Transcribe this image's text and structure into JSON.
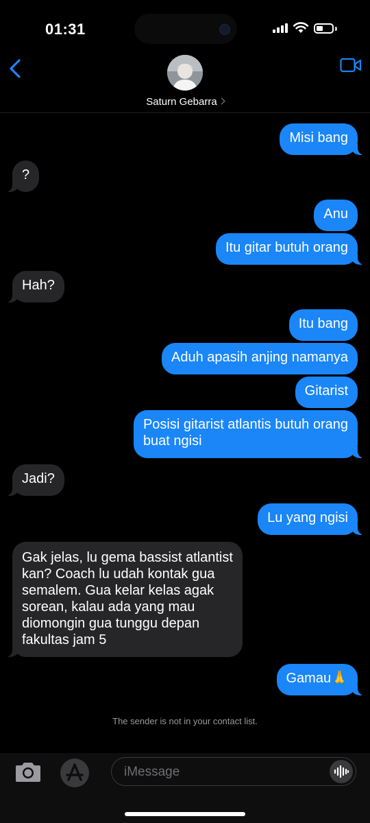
{
  "status": {
    "time": "01:31",
    "battery_level": 0.45
  },
  "header": {
    "contact_name": "Saturn Gebarra"
  },
  "messages": [
    {
      "dir": "out",
      "text": "Misi bang"
    },
    {
      "dir": "in",
      "text": "?"
    },
    {
      "dir": "out",
      "text": "Anu"
    },
    {
      "dir": "out",
      "text": "Itu gitar butuh orang"
    },
    {
      "dir": "in",
      "text": "Hah?"
    },
    {
      "dir": "out",
      "text": "Itu bang"
    },
    {
      "dir": "out",
      "text": "Aduh apasih anjing namanya"
    },
    {
      "dir": "out",
      "text": "Gitarist"
    },
    {
      "dir": "out",
      "text": "Posisi gitarist atlantis butuh orang\nbuat ngisi"
    },
    {
      "dir": "in",
      "text": "Jadi?"
    },
    {
      "dir": "out",
      "text": "Lu yang ngisi"
    },
    {
      "dir": "in",
      "text": "Gak jelas, lu gema bassist atlantist\nkan? Coach lu udah kontak gua\nsemalem. Gua kelar kelas agak\nsorean, kalau ada yang mau\ndiomongin gua tunggu depan\nfakultas jam 5"
    },
    {
      "dir": "out",
      "text": "Gamau🙏"
    }
  ],
  "notice": "The sender is not in your contact list.",
  "composer": {
    "placeholder": "iMessage"
  },
  "colors": {
    "accent": "#1a86f8",
    "incoming": "#262628"
  }
}
